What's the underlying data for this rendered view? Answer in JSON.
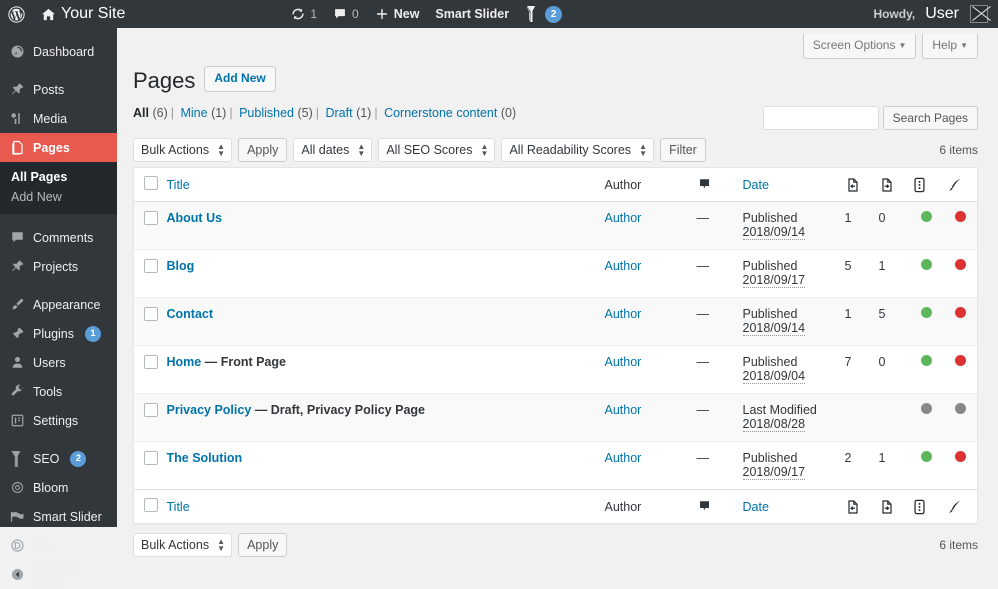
{
  "adminbar": {
    "wp_logo": "wordpress-logo-icon",
    "home_icon": "home-icon",
    "site_name": "Your Site",
    "updates_icon": "updates-icon",
    "updates_count": "1",
    "comments_icon": "comments-icon",
    "comments_count": "0",
    "new_icon": "plus-icon",
    "new_label": "New",
    "smart_slider_label": "Smart Slider",
    "seo_icon": "yoast-seo-icon",
    "seo_badge": "2",
    "howdy_label": "Howdy,",
    "user_name": "User",
    "avatar": "avatar-placeholder"
  },
  "sidebar": {
    "items": [
      {
        "label": "Dashboard",
        "icon": "dashboard-icon",
        "badge": ""
      },
      {
        "label": "Posts",
        "icon": "posts-pin-icon",
        "badge": ""
      },
      {
        "label": "Media",
        "icon": "media-icon",
        "badge": ""
      },
      {
        "label": "Pages",
        "icon": "pages-icon",
        "badge": ""
      },
      {
        "label": "Comments",
        "icon": "comments-icon",
        "badge": ""
      },
      {
        "label": "Projects",
        "icon": "projects-pin-icon",
        "badge": ""
      },
      {
        "label": "Appearance",
        "icon": "appearance-brush-icon",
        "badge": ""
      },
      {
        "label": "Plugins",
        "icon": "plugins-icon",
        "badge": "1"
      },
      {
        "label": "Users",
        "icon": "users-icon",
        "badge": ""
      },
      {
        "label": "Tools",
        "icon": "tools-wrench-icon",
        "badge": ""
      },
      {
        "label": "Settings",
        "icon": "settings-icon",
        "badge": ""
      },
      {
        "label": "SEO",
        "icon": "yoast-seo-icon",
        "badge": "2"
      },
      {
        "label": "Bloom",
        "icon": "bloom-icon",
        "badge": ""
      },
      {
        "label": "Smart Slider",
        "icon": "smart-slider-icon",
        "badge": ""
      },
      {
        "label": "Divi",
        "icon": "divi-icon",
        "badge": ""
      },
      {
        "label": "Collapse menu",
        "icon": "collapse-arrow-icon",
        "badge": ""
      }
    ],
    "submenu": {
      "all_pages": "All Pages",
      "add_new": "Add New"
    },
    "current_item": "Pages",
    "accent_color": "#e8594f"
  },
  "screen_meta": {
    "screen_options": "Screen Options",
    "help": "Help"
  },
  "header": {
    "title": "Pages",
    "add_new": "Add New"
  },
  "views": [
    {
      "label": "All",
      "count": "(6)",
      "current": true
    },
    {
      "label": "Mine",
      "count": "(1)",
      "current": false
    },
    {
      "label": "Published",
      "count": "(5)",
      "current": false
    },
    {
      "label": "Draft",
      "count": "(1)",
      "current": false
    },
    {
      "label": "Cornerstone content",
      "count": "(0)",
      "current": false
    }
  ],
  "search": {
    "value": "",
    "placeholder": "",
    "button": "Search Pages"
  },
  "tablenav_top": {
    "bulk_actions": "Bulk Actions",
    "apply": "Apply",
    "dates": "All dates",
    "seo_scores": "All SEO Scores",
    "readability_scores": "All Readability Scores",
    "filter": "Filter",
    "items": "6 items"
  },
  "tablenav_bottom": {
    "bulk_actions": "Bulk Actions",
    "apply": "Apply",
    "items": "6 items"
  },
  "table": {
    "columns": {
      "title": "Title",
      "author": "Author",
      "comments_icon": "comment-bubble-icon",
      "date": "Date",
      "inbound_icon": "inbound-links-icon",
      "outbound_icon": "outbound-links-icon",
      "seo_icon": "seo-score-icon",
      "readability_icon": "readability-pen-icon"
    },
    "rows": [
      {
        "title": "About Us",
        "note": "",
        "author": "Author",
        "comments": "—",
        "date_status": "Published",
        "date_value": "2018/09/14",
        "inbound": "1",
        "outbound": "0",
        "seo": "green",
        "readability": "red"
      },
      {
        "title": "Blog",
        "note": "",
        "author": "Author",
        "comments": "—",
        "date_status": "Published",
        "date_value": "2018/09/17",
        "inbound": "5",
        "outbound": "1",
        "seo": "green",
        "readability": "red"
      },
      {
        "title": "Contact",
        "note": "",
        "author": "Author",
        "comments": "—",
        "date_status": "Published",
        "date_value": "2018/09/14",
        "inbound": "1",
        "outbound": "5",
        "seo": "green",
        "readability": "red"
      },
      {
        "title": "Home",
        "note": "— Front Page",
        "author": "Author",
        "comments": "—",
        "date_status": "Published",
        "date_value": "2018/09/04",
        "inbound": "7",
        "outbound": "0",
        "seo": "green",
        "readability": "red"
      },
      {
        "title": "Privacy Policy",
        "note": "— Draft, Privacy Policy Page",
        "author": "Author",
        "comments": "—",
        "date_status": "Last Modified",
        "date_value": "2018/08/28",
        "inbound": "",
        "outbound": "",
        "seo": "grey",
        "readability": "grey"
      },
      {
        "title": "The Solution",
        "note": "",
        "author": "Author",
        "comments": "—",
        "date_status": "Published",
        "date_value": "2018/09/17",
        "inbound": "2",
        "outbound": "1",
        "seo": "green",
        "readability": "red"
      }
    ]
  },
  "colors": {
    "sidebar_bg": "#32373c",
    "submenu_bg": "#23282d",
    "current_menu": "#e8594f",
    "link": "#0073aa",
    "badge": "#5b9dd9",
    "dot_green": "#5cb85c",
    "dot_red": "#dc3232",
    "dot_grey": "#888888"
  }
}
